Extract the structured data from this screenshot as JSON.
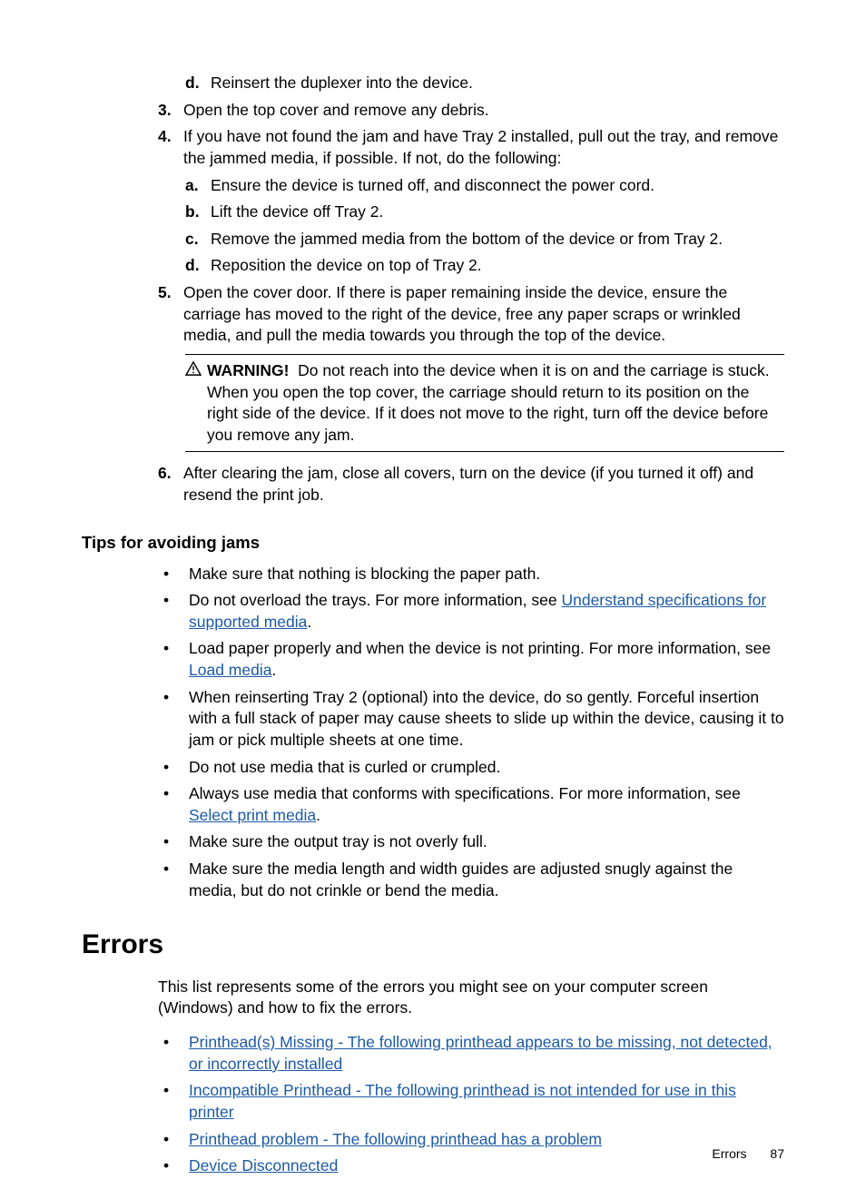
{
  "step_d_reinsert": {
    "marker": "d",
    "text": "Reinsert the duplexer into the device."
  },
  "step_3": {
    "marker": "3.",
    "text": "Open the top cover and remove any debris."
  },
  "step_4": {
    "marker": "4.",
    "text": "If you have not found the jam and have Tray 2 installed, pull out the tray, and remove the jammed media, if possible. If not, do the following:"
  },
  "step_4a": {
    "marker": "a",
    "text": "Ensure the device is turned off, and disconnect the power cord."
  },
  "step_4b": {
    "marker": "b",
    "text": "Lift the device off Tray 2."
  },
  "step_4c": {
    "marker": "c",
    "text": "Remove the jammed media from the bottom of the device or from Tray 2."
  },
  "step_4d": {
    "marker": "d",
    "text": "Reposition the device on top of Tray 2."
  },
  "step_5": {
    "marker": "5.",
    "text": "Open the cover door. If there is paper remaining inside the device, ensure the carriage has moved to the right of the device, free any paper scraps or wrinkled media, and pull the media towards you through the top of the device."
  },
  "warning": {
    "label": "WARNING!",
    "text": "Do not reach into the device when it is on and the carriage is stuck. When you open the top cover, the carriage should return to its position on the right side of the device. If it does not move to the right, turn off the device before you remove any jam."
  },
  "step_6": {
    "marker": "6.",
    "text": "After clearing the jam, close all covers, turn on the device (if you turned it off) and resend the print job."
  },
  "tips_heading": "Tips for avoiding jams",
  "tip1": "Make sure that nothing is blocking the paper path.",
  "tip2_pre": "Do not overload the trays. For more information, see ",
  "tip2_link": "Understand specifications for supported media",
  "tip3_pre": "Load paper properly and when the device is not printing. For more information, see ",
  "tip3_link": "Load media",
  "tip4": "When reinserting Tray 2 (optional) into the device, do so gently. Forceful insertion with a full stack of paper may cause sheets to slide up within the device, causing it to jam or pick multiple sheets at one time.",
  "tip5": "Do not use media that is curled or crumpled.",
  "tip6_pre": "Always use media that conforms with specifications. For more information, see ",
  "tip6_link": "Select print media",
  "tip7": "Make sure the output tray is not overly full.",
  "tip8": "Make sure the media length and width guides are adjusted snugly against the media, but do not crinkle or bend the media.",
  "errors_heading": "Errors",
  "errors_intro": "This list represents some of the errors you might see on your computer screen (Windows) and how to fix the errors.",
  "err1": "Printhead(s) Missing - The following printhead appears to be missing, not detected, or incorrectly installed",
  "err2": "Incompatible Printhead - The following printhead is not intended for use in this printer",
  "err3": "Printhead problem - The following printhead has a problem",
  "err4": "Device Disconnected",
  "footer_label": "Errors",
  "footer_page": "87",
  "period": "."
}
